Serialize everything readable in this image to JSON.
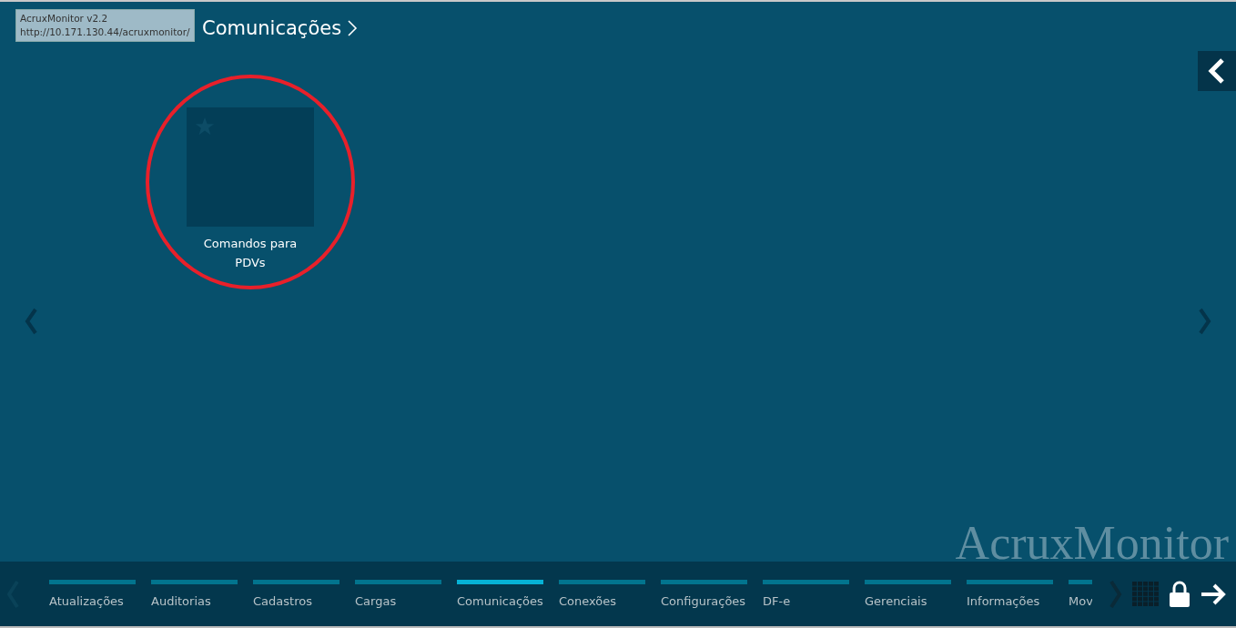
{
  "header": {
    "title": "Comunicações"
  },
  "tooltip": {
    "lines": [
      "AcruxMonitor v2.2",
      "http://10.171.130.44/acruxmonitor/"
    ]
  },
  "tiles": [
    {
      "label": "Comandos para PDVs",
      "highlighted": true
    }
  ],
  "brand": "AcruxMonitor",
  "tabs": [
    {
      "label": "Atualizações",
      "selected": false
    },
    {
      "label": "Auditorias",
      "selected": false
    },
    {
      "label": "Cadastros",
      "selected": false
    },
    {
      "label": "Cargas",
      "selected": false
    },
    {
      "label": "Comunicações",
      "selected": true
    },
    {
      "label": "Conexões",
      "selected": false
    },
    {
      "label": "Configurações",
      "selected": false
    },
    {
      "label": "DF-e",
      "selected": false
    },
    {
      "label": "Gerenciais",
      "selected": false
    },
    {
      "label": "Informações",
      "selected": false
    },
    {
      "label": "Mov",
      "selected": false
    }
  ]
}
